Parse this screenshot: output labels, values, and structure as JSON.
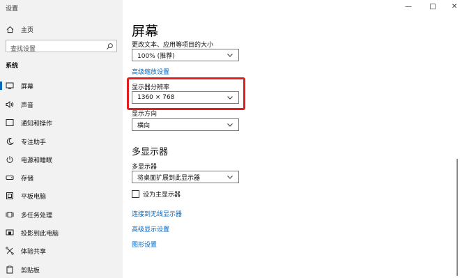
{
  "app": {
    "title": "设置"
  },
  "window_controls": {
    "minimize": "—",
    "maximize": "□",
    "close": "✕"
  },
  "sidebar": {
    "home_label": "主页",
    "search_placeholder": "查找设置",
    "section_label": "系统",
    "items": [
      {
        "label": "屏幕",
        "icon": "monitor-icon",
        "active": true
      },
      {
        "label": "声音",
        "icon": "speaker-icon"
      },
      {
        "label": "通知和操作",
        "icon": "notification-icon"
      },
      {
        "label": "专注助手",
        "icon": "moon-icon"
      },
      {
        "label": "电源和睡眠",
        "icon": "power-icon"
      },
      {
        "label": "存储",
        "icon": "storage-icon"
      },
      {
        "label": "平板电脑",
        "icon": "tablet-icon"
      },
      {
        "label": "多任务处理",
        "icon": "multitask-icon"
      },
      {
        "label": "投影到此电脑",
        "icon": "project-icon"
      },
      {
        "label": "体验共享",
        "icon": "share-icon"
      },
      {
        "label": "剪贴板",
        "icon": "clipboard-icon"
      }
    ]
  },
  "main": {
    "title": "屏幕",
    "scale_label": "更改文本、应用等项目的大小",
    "scale_value": "100% (推荐)",
    "advanced_scaling_link": "高级缩放设置",
    "resolution_label": "显示器分辨率",
    "resolution_value": "1360 × 768",
    "orientation_label": "显示方向",
    "orientation_value": "横向",
    "multi_display_heading": "多显示器",
    "multi_display_label": "多显示器",
    "multi_display_value": "将桌面扩展到此显示器",
    "main_display_checkbox": "设为主显示器",
    "wireless_link": "连接到无线显示器",
    "advanced_display_link": "高级显示设置",
    "graphics_link": "图形设置"
  },
  "colors": {
    "accent": "#0067c0",
    "highlight": "#e02020",
    "sidebar_bg": "#f2f2f2"
  }
}
